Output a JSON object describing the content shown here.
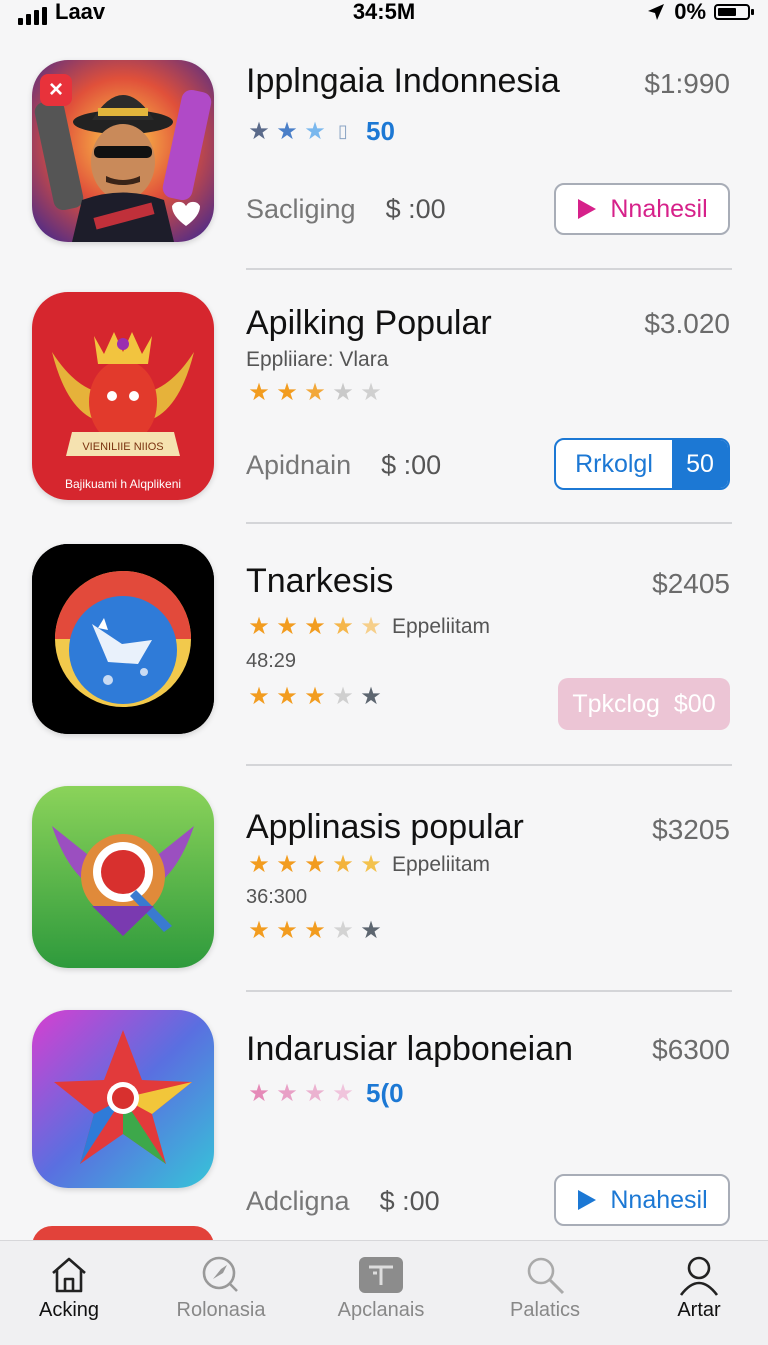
{
  "status": {
    "carrier": "Laav",
    "time": "34:5M",
    "battery": "0%"
  },
  "apps": [
    {
      "title": "Ipplngaia Indonnesia",
      "price": "$1:990",
      "rating_num": "50",
      "bottom_label": "Sacliging",
      "bottom_amount": "$ :00",
      "button": "Nnahesil"
    },
    {
      "title": "Apilking Popular",
      "price": "$3.020",
      "subtitle": "Eppliiare: Vlara",
      "bottom_label": "Apidnain",
      "bottom_amount": "$ :00",
      "button": "Rrkolgl",
      "button_badge": "50",
      "icon_banner": "VIENILIIE NIIOS",
      "icon_caption": "Bajikuami h Alqplikeni"
    },
    {
      "title": "Tnarkesis",
      "price": "$2405",
      "rating_label": "Eppeliitam",
      "meta": "48:29",
      "button": "Tpkclog",
      "button_badge": "$00"
    },
    {
      "title": "Applinasis popular",
      "price": "$3205",
      "rating_label": "Eppeliitam",
      "meta": "36:300"
    },
    {
      "title": "Indarusiar lapboneian",
      "price": "$6300",
      "rating_num": "5(0",
      "bottom_label": "Adcligna",
      "bottom_amount": "$ :00",
      "button": "Nnahesil"
    }
  ],
  "tabs": [
    {
      "label": "Acking",
      "icon": "home-icon"
    },
    {
      "label": "Rolonasia",
      "icon": "compass-icon"
    },
    {
      "label": "Apclanais",
      "icon": "apps-icon"
    },
    {
      "label": "Palatics",
      "icon": "search-icon"
    },
    {
      "label": "Artar",
      "icon": "profile-icon"
    }
  ],
  "colors": {
    "accent": "#1c78d4",
    "play_pink": "#d6218a",
    "button_pink": "#ecc5d5",
    "star_orange": "#f29c1f"
  }
}
